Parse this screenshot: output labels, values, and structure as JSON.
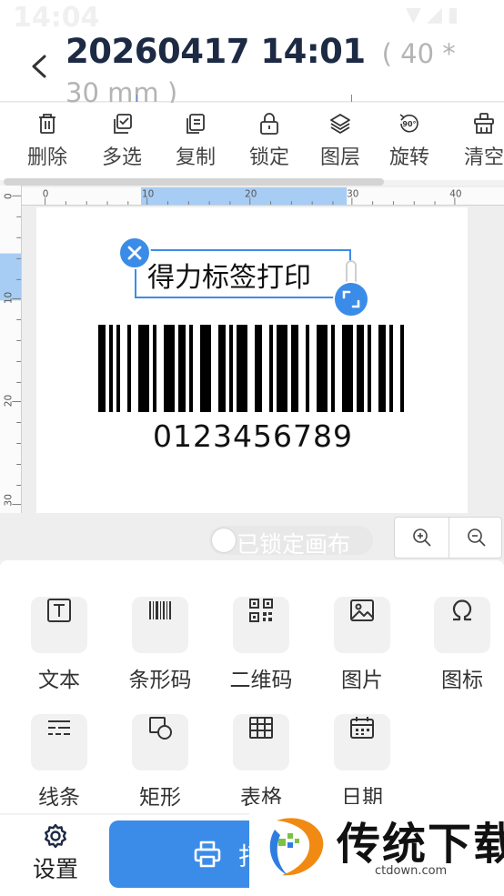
{
  "status_bar": {
    "time": "14:04"
  },
  "header": {
    "title": "20260417 14:01",
    "size_label": "( 40 * 30 mm )"
  },
  "toolbar": {
    "items": [
      {
        "label": "删除",
        "icon": "trash-icon"
      },
      {
        "label": "多选",
        "icon": "multi-select-icon"
      },
      {
        "label": "复制",
        "icon": "copy-icon"
      },
      {
        "label": "锁定",
        "icon": "lock-icon"
      },
      {
        "label": "图层",
        "icon": "layers-icon"
      },
      {
        "label": "旋转",
        "icon": "rotate-90-icon"
      },
      {
        "label": "清空",
        "icon": "clear-icon"
      }
    ],
    "rotate_badge": "90°"
  },
  "canvas": {
    "h_ruler_ticks": [
      "0",
      "10",
      "20",
      "30",
      "40"
    ],
    "v_ruler_ticks": [
      "0",
      "10",
      "20",
      "30"
    ],
    "text_element": "得力标签打印",
    "barcode_value": "0123456789",
    "lock_toggle_label": "已锁定画布",
    "lock_toggle_on": false
  },
  "elements": {
    "items": [
      {
        "label": "文本",
        "icon": "text-icon"
      },
      {
        "label": "条形码",
        "icon": "barcode-icon"
      },
      {
        "label": "二维码",
        "icon": "qrcode-icon"
      },
      {
        "label": "图片",
        "icon": "image-icon"
      },
      {
        "label": "图标",
        "icon": "omega-icon"
      },
      {
        "label": "线条",
        "icon": "line-icon"
      },
      {
        "label": "矩形",
        "icon": "shape-icon"
      },
      {
        "label": "表格",
        "icon": "table-icon"
      },
      {
        "label": "日期",
        "icon": "calendar-icon"
      }
    ]
  },
  "bottom_bar": {
    "settings_label": "设置",
    "print_label": "打"
  },
  "watermark": {
    "name": "传统下载",
    "url": "ctdown.com"
  },
  "colors": {
    "accent": "#3b8ce8",
    "title": "#1d2a44"
  }
}
